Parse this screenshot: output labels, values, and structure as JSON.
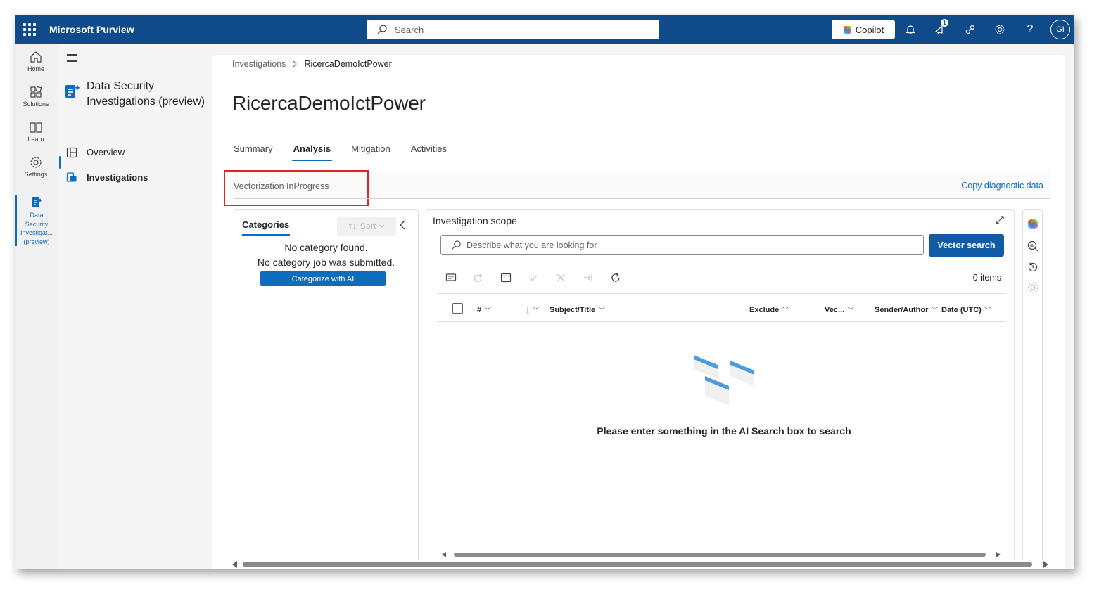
{
  "app": {
    "brand": "Microsoft Purview"
  },
  "topbar": {
    "search_placeholder": "Search",
    "copilot_label": "Copilot",
    "notification_count": "1",
    "avatar_initials": "GI"
  },
  "rail": {
    "items": [
      {
        "label": "Home",
        "icon": "home-icon"
      },
      {
        "label": "Solutions",
        "icon": "solutions-icon"
      },
      {
        "label": "Learn",
        "icon": "book-icon"
      },
      {
        "label": "Settings",
        "icon": "gear-icon"
      }
    ],
    "active_lines": [
      "Data",
      "Security",
      "Investigat...",
      "(preview)"
    ]
  },
  "nav": {
    "title": "Data Security Investigations (preview)",
    "links": [
      {
        "label": "Overview",
        "icon": "overview-icon"
      },
      {
        "label": "Investigations",
        "icon": "investigations-icon",
        "active": true
      }
    ]
  },
  "breadcrumb": {
    "parent": "Investigations",
    "current": "RicercaDemoIctPower"
  },
  "page": {
    "title": "RicercaDemoIctPower",
    "tabs": [
      "Summary",
      "Analysis",
      "Mitigation",
      "Activities"
    ],
    "active_tab": "Analysis",
    "status": "Vectorization InProgress",
    "copy_diagnostic": "Copy diagnostic data"
  },
  "categories": {
    "tab": "Categories",
    "sort_label": "Sort",
    "empty_line1": "No category found.",
    "empty_line2": "No category job was submitted.",
    "categorize_button": "Categorize with AI"
  },
  "scope": {
    "title": "Investigation scope",
    "input_placeholder": "Describe what you are looking for",
    "vector_button": "Vector search",
    "items_count": "0 items",
    "columns": [
      "#",
      "[",
      "Subject/Title",
      "Exclude",
      "Vec...",
      "Sender/Author",
      "Date (UTC)"
    ],
    "empty_message": "Please enter something in the AI Search box to search"
  },
  "colors": {
    "brand_blue": "#0f4a8a",
    "accent": "#0f6cbd",
    "highlight_red": "#e02424"
  }
}
